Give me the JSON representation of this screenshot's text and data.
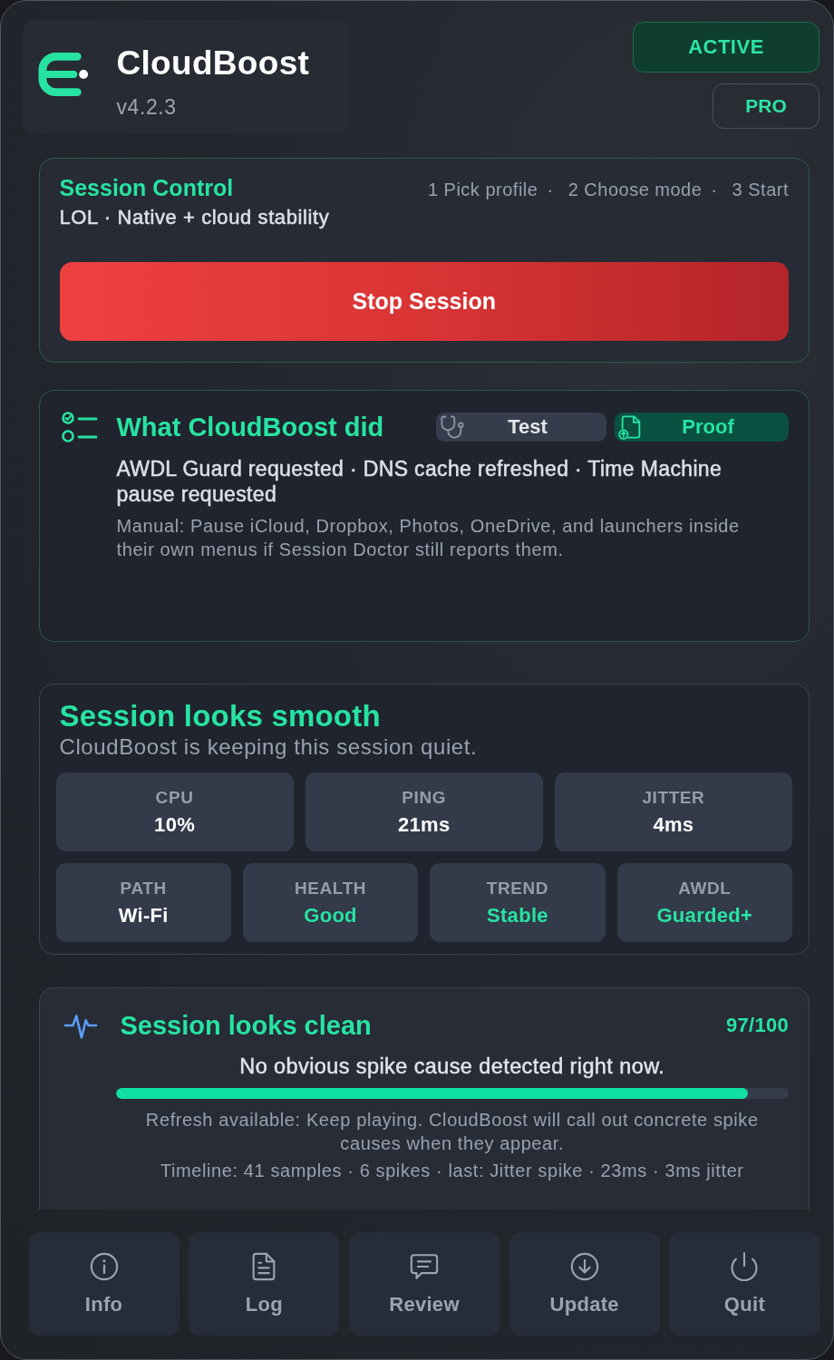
{
  "header": {
    "app_name": "CloudBoost",
    "version": "v4.2.3",
    "status_badge": "ACTIVE",
    "plan_badge": "PRO"
  },
  "session_control": {
    "title": "Session Control",
    "steps": [
      {
        "label": "1 Pick profile"
      },
      {
        "separator": "·",
        "label": "2 Choose mode"
      },
      {
        "separator": "·",
        "label": "3 Start"
      }
    ],
    "subtitle": "LOL · Native + cloud stability",
    "primary_button": "Stop Session"
  },
  "actions_card": {
    "title": "What CloudBoost did",
    "tabs": [
      {
        "kind": "test",
        "label": "Test",
        "selected": false
      },
      {
        "kind": "proof",
        "label": "Proof",
        "selected": true
      }
    ],
    "summary": "AWDL Guard requested · DNS cache refreshed · Time Machine pause requested",
    "note": "Manual: Pause iCloud, Dropbox, Photos, OneDrive, and launchers inside their own menus if Session Doctor still reports them."
  },
  "status_card": {
    "title": "Session looks smooth",
    "subtitle": "CloudBoost is keeping this session quiet.",
    "metric_rows": [
      [
        {
          "label": "CPU",
          "value": "10%",
          "highlighted": false
        },
        {
          "label": "PING",
          "value": "21ms",
          "highlighted": false
        },
        {
          "label": "JITTER",
          "value": "4ms",
          "highlighted": false
        }
      ],
      [
        {
          "label": "PATH",
          "value": "Wi-Fi",
          "highlighted": false
        },
        {
          "label": "HEALTH",
          "value": "Good",
          "highlighted": true
        },
        {
          "label": "TREND",
          "value": "Stable",
          "highlighted": true
        },
        {
          "label": "AWDL",
          "value": "Guarded+",
          "highlighted": true
        }
      ]
    ]
  },
  "diagnosis_card": {
    "title": "Session looks clean",
    "score": "97/100",
    "headline": "No obvious spike cause detected right now.",
    "progress": {
      "level": 0.94
    },
    "detail": "Refresh available: Keep playing. CloudBoost will call out concrete spike causes when they appear.",
    "timeline": "Timeline: 41 samples · 6 spikes · last: Jitter spike · 23ms · 3ms jitter"
  },
  "toolbar": [
    {
      "kind": "info",
      "label": "Info"
    },
    {
      "kind": "log",
      "label": "Log"
    },
    {
      "kind": "review",
      "label": "Review"
    },
    {
      "kind": "update",
      "label": "Update"
    },
    {
      "kind": "quit",
      "label": "Quit"
    }
  ]
}
